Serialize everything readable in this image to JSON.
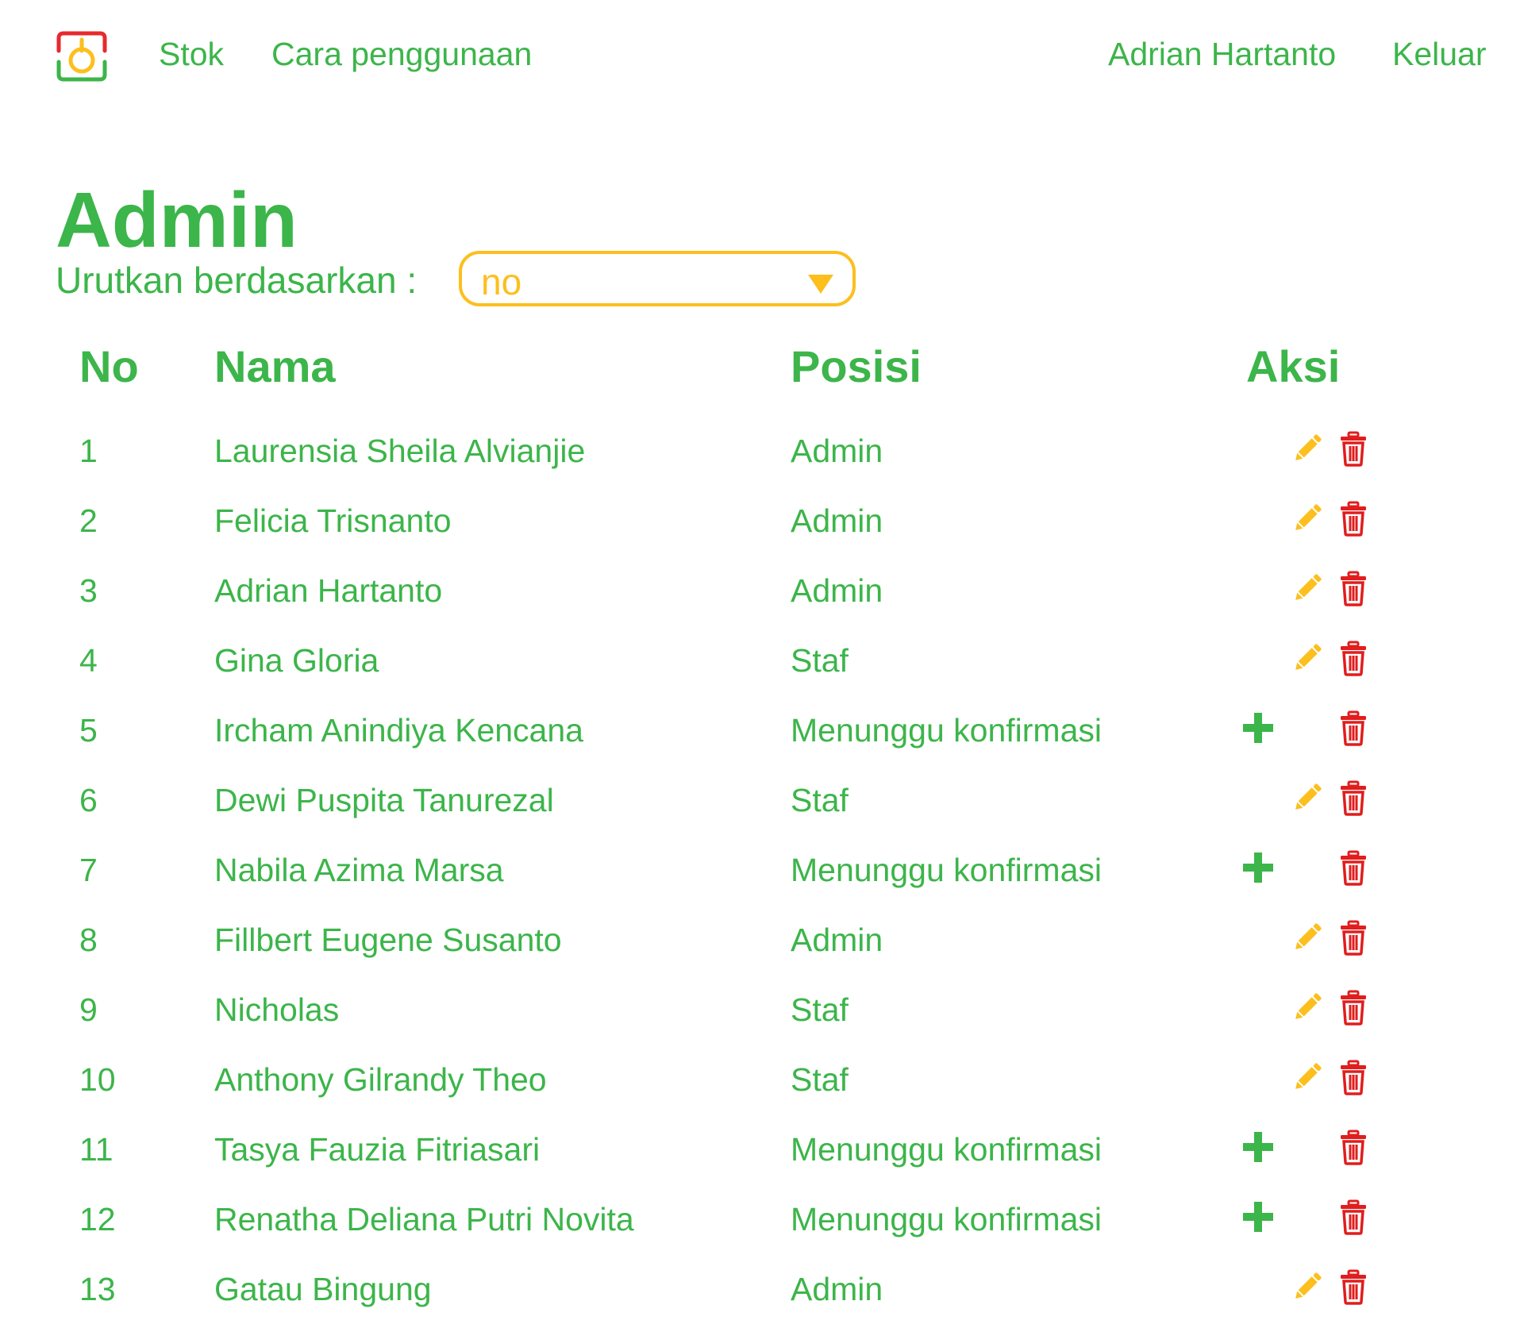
{
  "nav": {
    "logo_icon": "logo-icon",
    "links": [
      "Stok",
      "Cara penggunaan"
    ],
    "user_name": "Adrian Hartanto",
    "logout_label": "Keluar"
  },
  "page": {
    "title": "Admin",
    "sort_label": "Urutkan berdasarkan :",
    "sort_value": "no"
  },
  "table": {
    "headers": {
      "no": "No",
      "name": "Nama",
      "position": "Posisi",
      "action": "Aksi"
    },
    "rows": [
      {
        "no": "1",
        "name": "Laurensia Sheila Alvianjie",
        "position": "Admin",
        "actions": [
          "edit-icon",
          "delete-icon"
        ]
      },
      {
        "no": "2",
        "name": "Felicia Trisnanto",
        "position": "Admin",
        "actions": [
          "edit-icon",
          "delete-icon"
        ]
      },
      {
        "no": "3",
        "name": "Adrian Hartanto",
        "position": "Admin",
        "actions": [
          "edit-icon",
          "delete-icon"
        ]
      },
      {
        "no": "4",
        "name": "Gina Gloria",
        "position": "Staf",
        "actions": [
          "edit-icon",
          "delete-icon"
        ]
      },
      {
        "no": "5",
        "name": "Ircham Anindiya Kencana",
        "position": "Menunggu konfirmasi",
        "actions": [
          "plus-icon",
          "delete-icon"
        ]
      },
      {
        "no": "6",
        "name": "Dewi Puspita Tanurezal",
        "position": "Staf",
        "actions": [
          "edit-icon",
          "delete-icon"
        ]
      },
      {
        "no": "7",
        "name": "Nabila Azima Marsa",
        "position": "Menunggu konfirmasi",
        "actions": [
          "plus-icon",
          "delete-icon"
        ]
      },
      {
        "no": "8",
        "name": "Fillbert Eugene Susanto",
        "position": "Admin",
        "actions": [
          "edit-icon",
          "delete-icon"
        ]
      },
      {
        "no": "9",
        "name": "Nicholas",
        "position": "Staf",
        "actions": [
          "edit-icon",
          "delete-icon"
        ]
      },
      {
        "no": "10",
        "name": "Anthony Gilrandy Theo",
        "position": "Staf",
        "actions": [
          "edit-icon",
          "delete-icon"
        ]
      },
      {
        "no": "11",
        "name": "Tasya Fauzia Fitriasari",
        "position": "Menunggu konfirmasi",
        "actions": [
          "plus-icon",
          "delete-icon"
        ]
      },
      {
        "no": "12",
        "name": "Renatha Deliana Putri Novita",
        "position": "Menunggu konfirmasi",
        "actions": [
          "plus-icon",
          "delete-icon"
        ]
      },
      {
        "no": "13",
        "name": "Gatau Bingung",
        "position": "Admin",
        "actions": [
          "edit-icon",
          "delete-icon"
        ]
      }
    ]
  },
  "colors": {
    "primary": "#3cb54a",
    "accent": "#fcbf1e",
    "danger": "#e11d1d",
    "logo_red": "#e8292d",
    "background": "#ffffff"
  }
}
